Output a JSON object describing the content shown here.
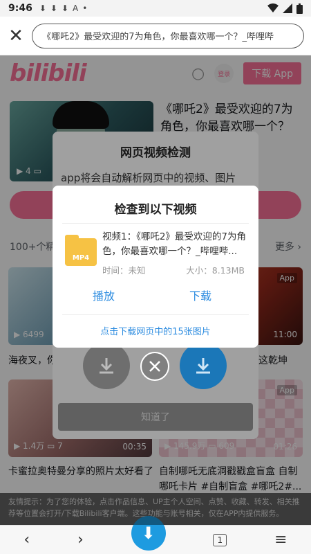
{
  "status_bar": {
    "time": "9:46",
    "notifications": [
      "⬇",
      "⬇",
      "⬇",
      "A",
      "•"
    ],
    "right_icons": [
      "wifi-icon",
      "signal-icon",
      "battery-icon"
    ]
  },
  "browser": {
    "close_icon": "✕",
    "url": "《哪吒2》最受欢迎的7为角色，你最喜欢哪一个？_哔哩哔"
  },
  "bili": {
    "logo": "bilibili",
    "search_icon": "○",
    "login_label": "登录",
    "download_app_label": "下载 App",
    "hero": {
      "title": "《哪吒2》最受欢迎的7为角色，你最喜欢哪一个？",
      "stats": "▶ 4 ▭"
    },
    "rec_header": "100+个精",
    "rec_more": "更多 ›",
    "cards": [
      {
        "stats": "▶ 6499",
        "duration": "",
        "tag": "",
        "title": "海夜叉，你"
      },
      {
        "stats": "",
        "duration": "11:00",
        "tag": "App",
        "title": "这乾坤"
      },
      {
        "stats": "▶ 1.4万 ▭ 7",
        "duration": "00:35",
        "tag": "",
        "title": "卡蜜拉奥特曼分享的照片太好看了"
      },
      {
        "stats": "▶ 145.9万 ▭ 609",
        "duration": "01:26",
        "tag": "App",
        "title": "自制哪吒无底洞戳戳盒盲盒 自制哪吒卡片 #自制盲盒 #哪吒2#..."
      }
    ],
    "notice": "友情提示：为了您的体验，点击作品信息、UP主个人空间、点赞、收藏、转发、相关推荐等位置会打开/下载Bilibili客户端。这些功能与账号相关，仅在APP内提供服务。"
  },
  "nav": {
    "back": "‹",
    "forward": "›",
    "download": "⬇",
    "tabs_count": "1",
    "menu": "≡"
  },
  "detect_dialog": {
    "title": "网页视频检测",
    "description": "app将会自动解析网页中的视频、图片",
    "ok_label": "知道了"
  },
  "result_dialog": {
    "title": "检查到以下视频",
    "file_type": "MP4",
    "video_name": "视频1：《哪吒2》最受欢迎的7为角色，你最喜欢哪一个？_哔哩哔...",
    "time_label": "时间：未知",
    "size_label": "大小：8.13MB",
    "play_label": "播放",
    "download_label": "下载",
    "images_link": "点击下载网页中的15张图片"
  }
}
